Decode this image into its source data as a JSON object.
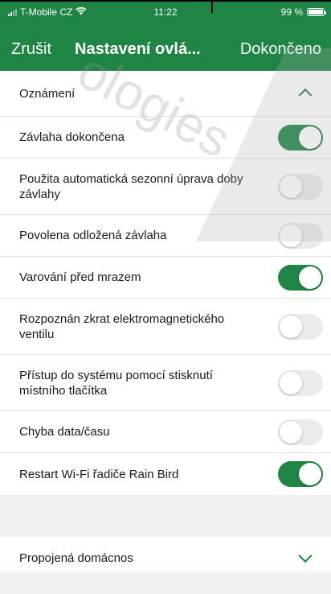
{
  "status": {
    "carrier": "T-Mobile CZ",
    "time": "11:22",
    "battery": "99 %"
  },
  "nav": {
    "cancel": "Zrušit",
    "title": "Nastavení ovlá...",
    "done": "Dokončeno"
  },
  "notifications": {
    "header": "Oznámení",
    "items": [
      {
        "label": "Závlaha dokončena",
        "on": true
      },
      {
        "label": "Použita automatická sezonní úprava doby závlahy",
        "on": false
      },
      {
        "label": "Povolena odložená závlaha",
        "on": false
      },
      {
        "label": "Varování před mrazem",
        "on": true
      },
      {
        "label": "Rozpoznán zkrat elektromagnetického ventilu",
        "on": false
      },
      {
        "label": "Přístup do systému pomocí stisknutí místního tlačítka",
        "on": false
      },
      {
        "label": "Chyba data/času",
        "on": false
      },
      {
        "label": "Restart Wi-Fi řadiče Rain Bird",
        "on": true
      }
    ]
  },
  "connected_home": {
    "header": "Propojená domácnos"
  },
  "watermark": "ologies",
  "colors": {
    "accent": "#1e8544",
    "toggle_off": "#ebebeb",
    "separator": "#e2e2e2"
  }
}
